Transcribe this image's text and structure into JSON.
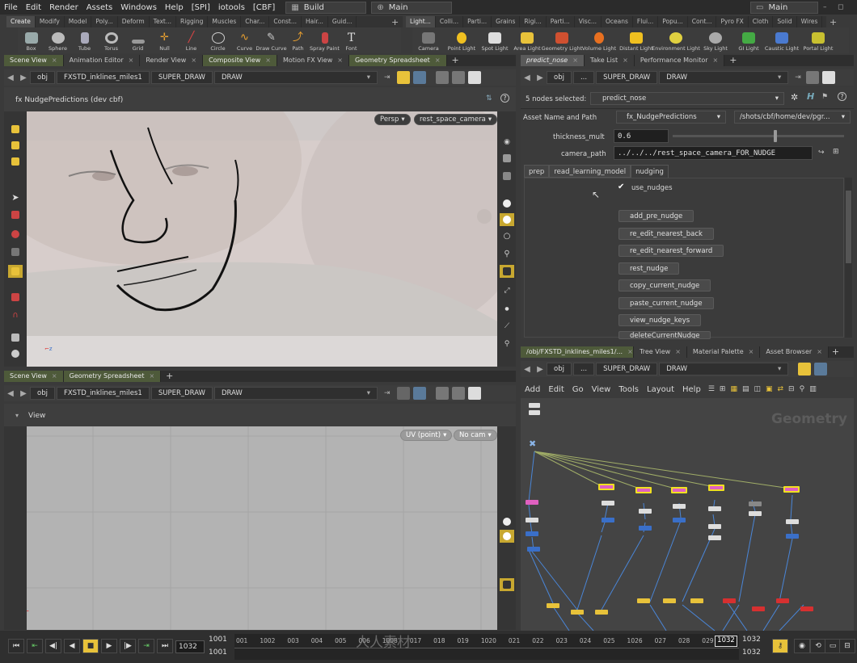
{
  "menubar": {
    "items": [
      "File",
      "Edit",
      "Render",
      "Assets",
      "Windows",
      "Help",
      "[SPI]",
      "iotools",
      "[CBF]"
    ],
    "desktop": "Build",
    "main_label": "Main",
    "right_label": "Main"
  },
  "shelf_left": {
    "tabs": [
      "Create",
      "Modify",
      "Model",
      "Poly...",
      "Deform",
      "Text...",
      "Rigging",
      "Muscles",
      "Char...",
      "Const...",
      "Hair...",
      "Guid..."
    ],
    "tools": [
      "Box",
      "Sphere",
      "Tube",
      "Torus",
      "Grid",
      "Null",
      "Line",
      "Circle",
      "Curve",
      "Draw Curve",
      "Path",
      "Spray Paint",
      "Font"
    ]
  },
  "shelf_right": {
    "tabs": [
      "Light...",
      "Colli...",
      "Parti...",
      "Grains",
      "Rigi...",
      "Parti...",
      "Visc...",
      "Oceans",
      "Flui...",
      "Popu...",
      "Cont...",
      "Pyro FX",
      "Cloth",
      "Solid",
      "Wires"
    ],
    "tools": [
      "Camera",
      "Point Light",
      "Spot Light",
      "Area Light",
      "Geometry Light",
      "Volume Light",
      "Distant Light",
      "Environment Light",
      "Sky Light",
      "GI Light",
      "Caustic Light",
      "Portal Light"
    ]
  },
  "top_left_pane": {
    "tabs": [
      "Scene View",
      "Animation Editor",
      "Render View",
      "Composite View",
      "Motion FX View",
      "Geometry Spreadsheet"
    ],
    "path": [
      "obj",
      "FXSTD_inklines_miles1",
      "SUPER_DRAW",
      "DRAW"
    ],
    "viewport_title": "fx NudgePredictions (dev cbf)",
    "persp": "Persp",
    "camera": "rest_space_camera",
    "axis_label": "z"
  },
  "bottom_left_pane": {
    "tabs": [
      "Scene View",
      "Geometry Spreadsheet"
    ],
    "path": [
      "obj",
      "FXSTD_inklines_miles1",
      "SUPER_DRAW",
      "DRAW"
    ],
    "view_label": "View",
    "uv_dropdown": "UV (point)",
    "cam_dropdown": "No cam"
  },
  "param_pane": {
    "tabs": [
      "predict_nose",
      "Take List",
      "Performance Monitor"
    ],
    "path": [
      "obj",
      "...",
      "SUPER_DRAW",
      "DRAW"
    ],
    "nodes_selected_label": "5 nodes selected:",
    "nodes_selected_value": "predict_nose",
    "asset_label": "Asset Name and Path",
    "asset_name": "fx_NudgePredictions",
    "asset_path": "/shots/cbf/home/dev/pgr...",
    "thickness_label": "thickness_mult",
    "thickness_value": "0.6",
    "thickness_fraction": 0.6,
    "camera_label": "camera_path",
    "camera_value": "../../../rest_space_camera_FOR_NUDGE",
    "subtabs": [
      "prep",
      "read_learning_model",
      "nudging"
    ],
    "toggle_label": "use_nudges",
    "buttons": [
      "add_pre_nudge",
      "re_edit_nearest_back",
      "re_edit_nearest_forward",
      "rest_nudge",
      "copy_current_nudge",
      "paste_current_nudge",
      "view_nudge_keys",
      "deleteCurrentNudge"
    ]
  },
  "network_pane": {
    "tabs": [
      "/obj/FXSTD_inklines_miles1/...",
      "Tree View",
      "Material Palette",
      "Asset Browser"
    ],
    "path": [
      "obj",
      "...",
      "SUPER_DRAW",
      "DRAW"
    ],
    "menu": [
      "Add",
      "Edit",
      "Go",
      "View",
      "Tools",
      "Layout",
      "Help"
    ],
    "watermark": "Geometry"
  },
  "timeline": {
    "current_frame": "1032",
    "start_top": "1001",
    "start_bottom": "1001",
    "end_frame": "1032",
    "end_top": "1032",
    "end_bottom": "1032",
    "ticks": [
      "001",
      "1002",
      "003",
      "004",
      "005",
      "006",
      "1008",
      "017",
      "018",
      "019",
      "1020",
      "021",
      "022",
      "023",
      "024",
      "025",
      "1026",
      "027",
      "028",
      "029",
      "030"
    ],
    "watermark": "人人素材"
  },
  "colors": {
    "accent_yellow": "#e8c23a",
    "active_tab": "#4e5a3a",
    "node_blue": "#3a6fc8",
    "node_yellow": "#e8c23a",
    "node_red": "#d63030",
    "node_pink": "#e060c0"
  }
}
